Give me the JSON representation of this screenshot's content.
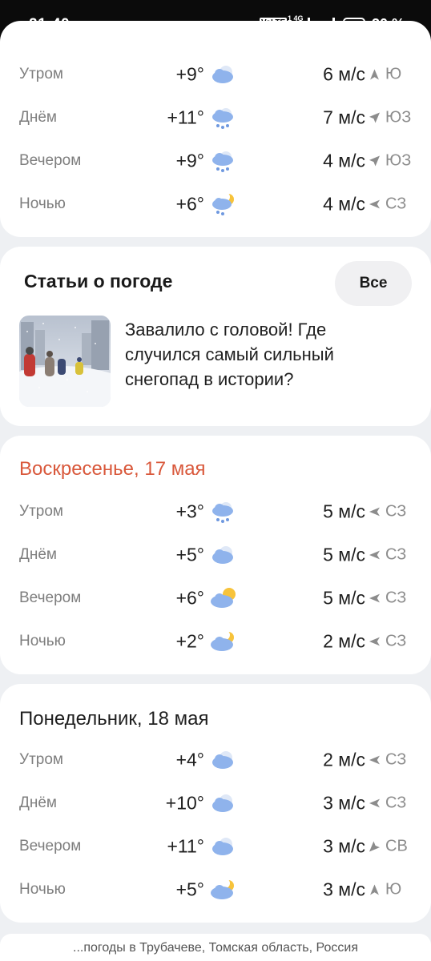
{
  "status_bar": {
    "time": "21:40",
    "volte": "VoLTE",
    "net_top": "1 4G",
    "net_bottom": "2",
    "battery": "30 %"
  },
  "card_top": {
    "rows": [
      {
        "period": "Утром",
        "temp": "+9°",
        "icon": "cloud-icon",
        "wind": "6 м/с",
        "dir": "Ю",
        "dir_arrow": "arrow-s-icon"
      },
      {
        "period": "Днём",
        "temp": "+11°",
        "icon": "rain-cloud-icon",
        "wind": "7 м/с",
        "dir": "ЮЗ",
        "dir_arrow": "arrow-sw-icon"
      },
      {
        "period": "Вечером",
        "temp": "+9°",
        "icon": "rain-cloud-icon",
        "wind": "4 м/с",
        "dir": "ЮЗ",
        "dir_arrow": "arrow-sw-icon"
      },
      {
        "period": "Ночью",
        "temp": "+6°",
        "icon": "moon-rain-cloud-icon",
        "wind": "4 м/с",
        "dir": "СЗ",
        "dir_arrow": "arrow-nw-icon"
      }
    ]
  },
  "articles": {
    "title": "Статьи о погоде",
    "all_button": "Все",
    "headline": "Завалило с головой! Где случился самый сильный снегопад в истории?"
  },
  "day_sunday": {
    "title": "Воскресенье, 17 мая",
    "title_color": "#d9583b",
    "rows": [
      {
        "period": "Утром",
        "temp": "+3°",
        "icon": "rain-cloud-icon",
        "wind": "5 м/с",
        "dir": "СЗ",
        "dir_arrow": "arrow-nw-icon"
      },
      {
        "period": "Днём",
        "temp": "+5°",
        "icon": "cloud-icon",
        "wind": "5 м/с",
        "dir": "СЗ",
        "dir_arrow": "arrow-nw-icon"
      },
      {
        "period": "Вечером",
        "temp": "+6°",
        "icon": "sun-cloud-icon",
        "wind": "5 м/с",
        "dir": "СЗ",
        "dir_arrow": "arrow-nw-icon"
      },
      {
        "period": "Ночью",
        "temp": "+2°",
        "icon": "moon-cloud-icon",
        "wind": "2 м/с",
        "dir": "СЗ",
        "dir_arrow": "arrow-nw-icon"
      }
    ]
  },
  "day_monday": {
    "title": "Понедельник, 18 мая",
    "rows": [
      {
        "period": "Утром",
        "temp": "+4°",
        "icon": "cloud-icon",
        "wind": "2 м/с",
        "dir": "СЗ",
        "dir_arrow": "arrow-nw-icon"
      },
      {
        "period": "Днём",
        "temp": "+10°",
        "icon": "cloud-icon",
        "wind": "3 м/с",
        "dir": "СЗ",
        "dir_arrow": "arrow-nw-icon"
      },
      {
        "period": "Вечером",
        "temp": "+11°",
        "icon": "cloud-icon",
        "wind": "3 м/с",
        "dir": "СВ",
        "dir_arrow": "arrow-ne-icon"
      },
      {
        "period": "Ночью",
        "temp": "+5°",
        "icon": "moon-cloud-icon",
        "wind": "3 м/с",
        "dir": "Ю",
        "dir_arrow": "arrow-s-icon"
      }
    ]
  },
  "footer": {
    "text": "...погоды в Трубачеве, Томская область, Россия"
  }
}
